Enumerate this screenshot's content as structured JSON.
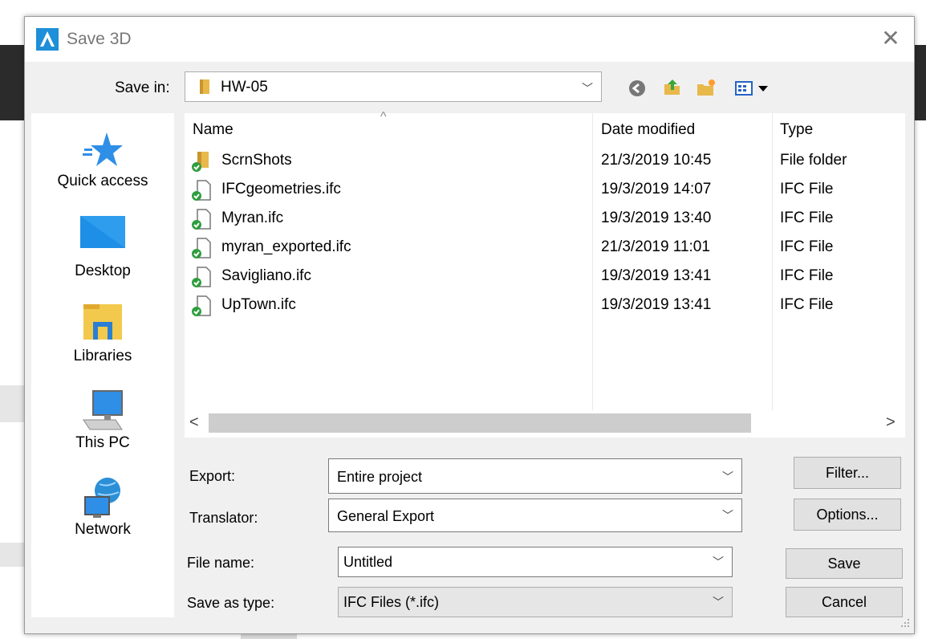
{
  "dialog": {
    "title": "Save 3D",
    "close_icon": "close-icon"
  },
  "save_in": {
    "label": "Save in:",
    "value": "HW-05",
    "toolbar_icons": [
      "back-icon",
      "up-folder-icon",
      "new-folder-icon",
      "view-menu-icon"
    ]
  },
  "places": [
    {
      "label": "Quick access",
      "icon": "star-icon"
    },
    {
      "label": "Desktop",
      "icon": "desktop-icon"
    },
    {
      "label": "Libraries",
      "icon": "libraries-icon"
    },
    {
      "label": "This PC",
      "icon": "computer-icon"
    },
    {
      "label": "Network",
      "icon": "network-icon"
    }
  ],
  "file_list": {
    "sort_indicator": "^",
    "headers": {
      "name": "Name",
      "date": "Date modified",
      "type": "Type"
    },
    "rows": [
      {
        "name": "ScrnShots",
        "date": "21/3/2019 10:45",
        "type": "File folder",
        "icon": "folder-icon"
      },
      {
        "name": "IFCgeometries.ifc",
        "date": "19/3/2019 14:07",
        "type": "IFC File",
        "icon": "ifc-file-icon"
      },
      {
        "name": "Myran.ifc",
        "date": "19/3/2019 13:40",
        "type": "IFC File",
        "icon": "ifc-file-icon"
      },
      {
        "name": "myran_exported.ifc",
        "date": "21/3/2019 11:01",
        "type": "IFC File",
        "icon": "ifc-file-icon"
      },
      {
        "name": "Savigliano.ifc",
        "date": "19/3/2019 13:41",
        "type": "IFC File",
        "icon": "ifc-file-icon"
      },
      {
        "name": "UpTown.ifc",
        "date": "19/3/2019 13:41",
        "type": "IFC File",
        "icon": "ifc-file-icon"
      }
    ]
  },
  "scroll": {
    "left": "<",
    "right": ">"
  },
  "form": {
    "export": {
      "label": "Export:",
      "value": "Entire project"
    },
    "translator": {
      "label": "Translator:",
      "value": "General Export"
    },
    "file_name": {
      "label": "File name:",
      "value": "Untitled"
    },
    "save_as_type": {
      "label": "Save as type:",
      "value": "IFC Files (*.ifc)"
    }
  },
  "buttons": {
    "filter": "Filter...",
    "options": "Options...",
    "save": "Save",
    "cancel": "Cancel"
  },
  "colors": {
    "accent": "#1e90ff",
    "folder": "#e8b84a",
    "check": "#2e9e3e"
  }
}
